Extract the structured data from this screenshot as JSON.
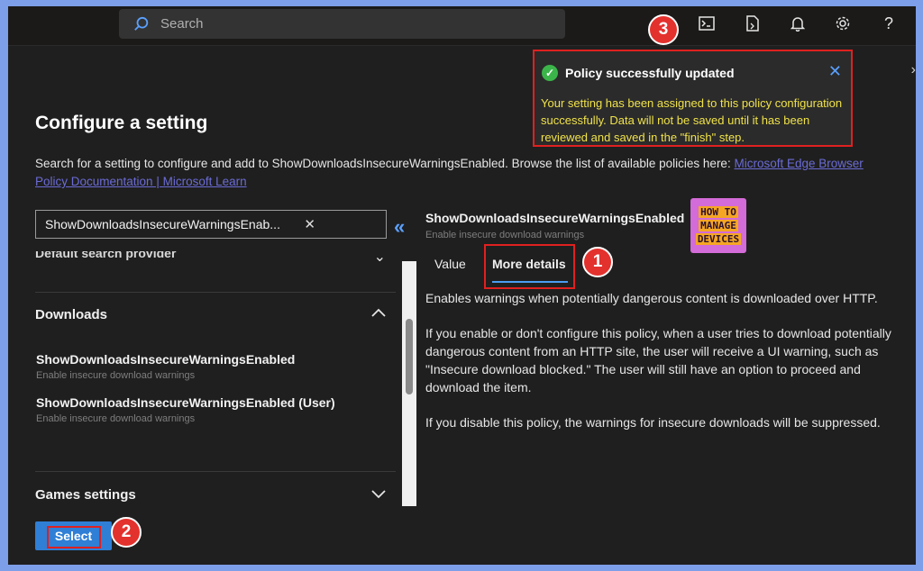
{
  "topbar": {
    "search_placeholder": "Search",
    "icons": [
      "terminal-icon",
      "directory-icon",
      "bell-icon",
      "gear-icon",
      "help-icon"
    ],
    "help_label": "?"
  },
  "page": {
    "title": "Configure a setting",
    "description": "Search for a setting to configure and add to ShowDownloadsInsecureWarningsEnabled. Browse the list of available policies here:",
    "link_text": "Microsoft Edge Browser Policy Documentation | Microsoft Learn"
  },
  "filter": {
    "value": "ShowDownloadsInsecureWarningsEnab...",
    "clear": "✕",
    "collapse": "«"
  },
  "list": {
    "partial_item": "Default search provider",
    "sections": [
      {
        "label": "Downloads",
        "expanded": true
      },
      {
        "label": "Games settings",
        "expanded": false
      }
    ],
    "items": [
      {
        "title": "ShowDownloadsInsecureWarningsEnabled",
        "subtitle": "Enable insecure download warnings"
      },
      {
        "title": "ShowDownloadsInsecureWarningsEnabled (User)",
        "subtitle": "Enable insecure download warnings"
      }
    ]
  },
  "select_button": "Select",
  "detail": {
    "title": "ShowDownloadsInsecureWarningsEnabled",
    "subtitle": "Enable insecure download warnings",
    "logo_lines": [
      "HOW TO",
      "MANAGE",
      "DEVICES"
    ],
    "tabs": [
      {
        "label": "Value",
        "selected": false
      },
      {
        "label": "More details",
        "selected": true
      }
    ],
    "paragraphs": [
      "Enables warnings when potentially dangerous content is downloaded over HTTP.",
      "If you enable or don't configure this policy, when a user tries to download potentially dangerous content from an HTTP site, the user will receive a UI warning, such as \"Insecure download blocked.\" The user will still have an option to proceed and download the item.",
      "If you disable this policy, the warnings for insecure downloads will be suppressed."
    ]
  },
  "toast": {
    "title": "Policy successfully updated",
    "message": "Your setting has been assigned to this policy configuration successfully. Data will not be saved until it has been reviewed and saved in the \"finish\" step."
  },
  "badges": [
    "1",
    "2",
    "3"
  ],
  "colors": {
    "accent": "#2f7fd6",
    "highlight": "#e02020",
    "toast_text": "#f0e24a",
    "success": "#3bb54a"
  }
}
